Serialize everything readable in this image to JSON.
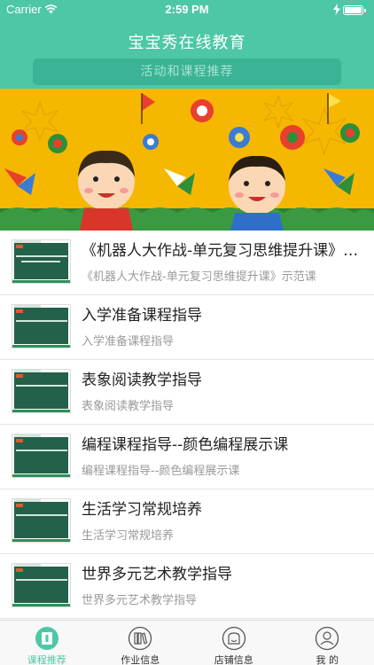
{
  "status_bar": {
    "carrier": "Carrier",
    "time": "2:59 PM"
  },
  "header": {
    "title": "宝宝秀在线教育",
    "search_text": "活动和课程推荐"
  },
  "colors": {
    "accent": "#4ec7a7",
    "banner_bg": "#f6b700"
  },
  "courses": [
    {
      "title": "《机器人大作战-单元复习思维提升课》示范课",
      "subtitle": "《机器人大作战-单元复习思维提升课》示范课"
    },
    {
      "title": "入学准备课程指导",
      "subtitle": "入学准备课程指导"
    },
    {
      "title": "表象阅读教学指导",
      "subtitle": "表象阅读教学指导"
    },
    {
      "title": "编程课程指导--颜色编程展示课",
      "subtitle": "编程课程指导--颜色编程展示课"
    },
    {
      "title": "生活学习常规培养",
      "subtitle": "生活学习常规培养"
    },
    {
      "title": "世界多元艺术教学指导",
      "subtitle": "世界多元艺术教学指导"
    }
  ],
  "tabs": [
    {
      "label": "课程推荐",
      "icon": "course-icon",
      "active": true
    },
    {
      "label": "作业信息",
      "icon": "books-icon",
      "active": false
    },
    {
      "label": "店铺信息",
      "icon": "store-icon",
      "active": false
    },
    {
      "label": "我    的",
      "icon": "user-icon",
      "active": false
    }
  ]
}
